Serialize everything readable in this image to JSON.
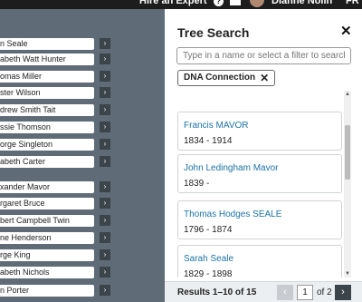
{
  "topbar": {
    "hire_label": "Hire an Expert",
    "help_icon": "question-icon",
    "mail_icon": "mail-icon",
    "user_name": "Dianne Nolin",
    "lang": "FR"
  },
  "tree": {
    "nodes": [
      {
        "label": "n Seale"
      },
      {
        "label": "abeth Watt Hunter"
      },
      {
        "label": "omas Miller"
      },
      {
        "label": "ster Wilson"
      },
      {
        "label": "drew Smith Tait"
      },
      {
        "label": "ssie Thomson"
      },
      {
        "label": "orge Singleton"
      },
      {
        "label": "abeth Carter"
      },
      {
        "label": "xander Mavor"
      },
      {
        "label": "rgaret Bruce"
      },
      {
        "label": "bert Campbell Twin"
      },
      {
        "label": "ne Henderson"
      },
      {
        "label": "rge King"
      },
      {
        "label": "abeth Nichols"
      },
      {
        "label": "n Porter"
      }
    ],
    "arrow": "›"
  },
  "panel": {
    "title": "Tree Search",
    "close_icon": "close-icon",
    "search_placeholder": "Type in a name or select a filter to search",
    "filter_chip": "DNA Connection",
    "chip_remove": "✕",
    "results": [
      {
        "name": "Francis MAVOR",
        "dates": "1834 - 1914"
      },
      {
        "name": "John Ledingham Mavor",
        "dates": "1839 -"
      },
      {
        "name": "Thomas Hodges SEALE",
        "dates": "1796 - 1874"
      },
      {
        "name": "Sarah Seale",
        "dates": "1829 - 1898"
      }
    ],
    "footer": {
      "count": "Results 1–10 of 15",
      "page": "1",
      "of": "of 2"
    }
  }
}
